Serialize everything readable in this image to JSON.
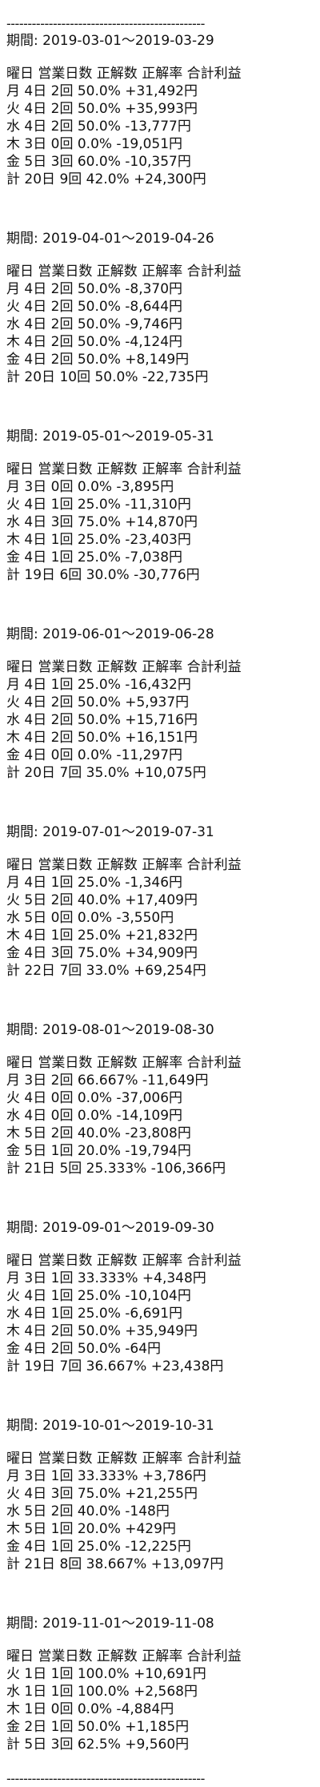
{
  "separator": "-----------------------------------------------",
  "blocks": [
    {
      "period": "期間: 2019-03-01～2019-03-29",
      "lines": [
        "曜日 営業日数 正解数 正解率 合計利益",
        "月 4日 2回 50.0% +31,492円",
        "火 4日 2回 50.0% +35,993円",
        "水 4日 2回 50.0% -13,777円",
        "木 3日 0回 0.0% -19,051円",
        "金 5日 3回 60.0% -10,357円",
        "計 20日 9回 42.0% +24,300円"
      ]
    },
    {
      "period": "期間: 2019-04-01～2019-04-26",
      "lines": [
        "曜日 営業日数 正解数 正解率 合計利益",
        "月 4日 2回 50.0% -8,370円",
        "火 4日 2回 50.0% -8,644円",
        "水 4日 2回 50.0% -9,746円",
        "木 4日 2回 50.0% -4,124円",
        "金 4日 2回 50.0% +8,149円",
        "計 20日 10回 50.0% -22,735円"
      ]
    },
    {
      "period": "期間: 2019-05-01～2019-05-31",
      "lines": [
        "曜日 営業日数 正解数 正解率 合計利益",
        "月 3日 0回 0.0% -3,895円",
        "火 4日 1回 25.0% -11,310円",
        "水 4日 3回 75.0% +14,870円",
        "木 4日 1回 25.0% -23,403円",
        "金 4日 1回 25.0% -7,038円",
        "計 19日 6回 30.0% -30,776円"
      ]
    },
    {
      "period": "期間: 2019-06-01～2019-06-28",
      "lines": [
        "曜日 営業日数 正解数 正解率 合計利益",
        "月 4日 1回 25.0% -16,432円",
        "火 4日 2回 50.0% +5,937円",
        "水 4日 2回 50.0% +15,716円",
        "木 4日 2回 50.0% +16,151円",
        "金 4日 0回 0.0% -11,297円",
        "計 20日 7回 35.0% +10,075円"
      ]
    },
    {
      "period": "期間: 2019-07-01～2019-07-31",
      "lines": [
        "曜日 営業日数 正解数 正解率 合計利益",
        "月 4日 1回 25.0% -1,346円",
        "火 5日 2回 40.0% +17,409円",
        "水 5日 0回 0.0% -3,550円",
        "木 4日 1回 25.0% +21,832円",
        "金 4日 3回 75.0% +34,909円",
        "計 22日 7回 33.0% +69,254円"
      ]
    },
    {
      "period": "期間: 2019-08-01～2019-08-30",
      "lines": [
        "曜日 営業日数 正解数 正解率 合計利益",
        "月 3日 2回 66.667% -11,649円",
        "火 4日 0回 0.0% -37,006円",
        "水 4日 0回 0.0% -14,109円",
        "木 5日 2回 40.0% -23,808円",
        "金 5日 1回 20.0% -19,794円",
        "計 21日 5回 25.333% -106,366円"
      ]
    },
    {
      "period": "期間: 2019-09-01～2019-09-30",
      "lines": [
        "曜日 営業日数 正解数 正解率 合計利益",
        "月 3日 1回 33.333% +4,348円",
        "火 4日 1回 25.0% -10,104円",
        "水 4日 1回 25.0% -6,691円",
        "木 4日 2回 50.0% +35,949円",
        "金 4日 2回 50.0% -64円",
        "計 19日 7回 36.667% +23,438円"
      ]
    },
    {
      "period": "期間: 2019-10-01～2019-10-31",
      "lines": [
        "曜日 営業日数 正解数 正解率 合計利益",
        "月 3日 1回 33.333% +3,786円",
        "火 4日 3回 75.0% +21,255円",
        "水 5日 2回 40.0% -148円",
        "木 5日 1回 20.0% +429円",
        "金 4日 1回 25.0% -12,225円",
        "計 21日 8回 38.667% +13,097円"
      ]
    },
    {
      "period": "期間: 2019-11-01～2019-11-08",
      "lines": [
        "曜日 営業日数 正解数 正解率 合計利益",
        "火 1日 1回 100.0% +10,691円",
        "水 1日 1回 100.0% +2,568円",
        "木 1日 0回 0.0% -4,884円",
        "金 2日 1回 50.0% +1,185円",
        "計 5日 3回 62.5% +9,560円"
      ]
    }
  ]
}
